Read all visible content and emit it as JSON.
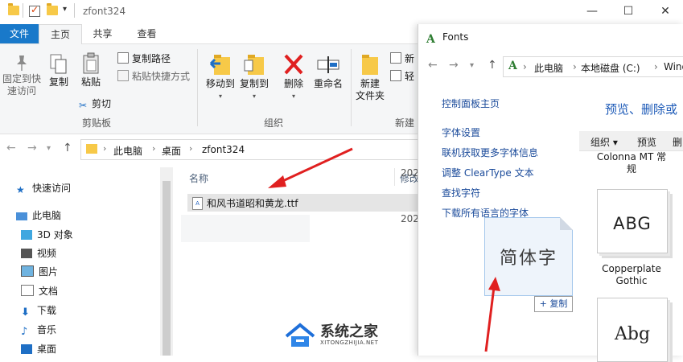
{
  "explorer": {
    "window_title": "zfont324",
    "tabs": [
      {
        "label": "文件"
      },
      {
        "label": "主页"
      },
      {
        "label": "共享"
      },
      {
        "label": "查看"
      }
    ],
    "ribbon": {
      "clipboard": {
        "pin_label": "固定到快\n速访问",
        "copy_label": "复制",
        "paste_label": "粘贴",
        "copy_path_label": "复制路径",
        "paste_shortcut_label": "粘贴快捷方式",
        "cut_label": "剪切",
        "group_label": "剪贴板"
      },
      "organize": {
        "move_to_label": "移动到",
        "copy_to_label": "复制到",
        "delete_label": "删除",
        "rename_label": "重命名",
        "group_label": "组织"
      },
      "new": {
        "new_folder_label": "新建\n文件夹",
        "new_item_label": "新",
        "easy_access_label": "轻",
        "group_label": "新建"
      }
    },
    "address": {
      "crumbs": [
        "此电脑",
        "桌面",
        "zfont324"
      ]
    },
    "nav": {
      "items": [
        {
          "label": "快速访问"
        },
        {
          "label": "此电脑"
        },
        {
          "label": "3D 对象"
        },
        {
          "label": "视频"
        },
        {
          "label": "图片"
        },
        {
          "label": "文档"
        },
        {
          "label": "下载"
        },
        {
          "label": "音乐"
        },
        {
          "label": "桌面"
        }
      ]
    },
    "filelist": {
      "col_name": "名称",
      "col_modified": "修改",
      "files": [
        {
          "name": "和风书道昭和黄龙.ttf",
          "date": "202"
        }
      ],
      "second_date": "202"
    }
  },
  "fonts_window": {
    "title": "Fonts",
    "address": {
      "crumbs": [
        "此电脑",
        "本地磁盘 (C:)",
        "Wind"
      ]
    },
    "links": [
      {
        "label": "控制面板主页"
      },
      {
        "label": "字体设置"
      },
      {
        "label": "联机获取更多字体信息"
      },
      {
        "label": "调整 ClearType 文本"
      },
      {
        "label": "查找字符"
      },
      {
        "label": "下载所有语言的字体"
      }
    ],
    "heading": "预览、删除或",
    "toolbar": {
      "organize_label": "组织 ▾",
      "preview_label": "预览",
      "delete_label": "删"
    },
    "fonts": [
      {
        "name": "Colonna MT 常\n规",
        "sample": ""
      },
      {
        "name": "Copperplate\nGothic",
        "sample": "ABG"
      },
      {
        "name": "",
        "sample": "Abg"
      }
    ]
  },
  "drag": {
    "sample_text": "简体字",
    "copy_label": "+ 复制"
  },
  "watermark": {
    "text": "系统之家",
    "sub": "XITONGZHIJIA.NET"
  }
}
